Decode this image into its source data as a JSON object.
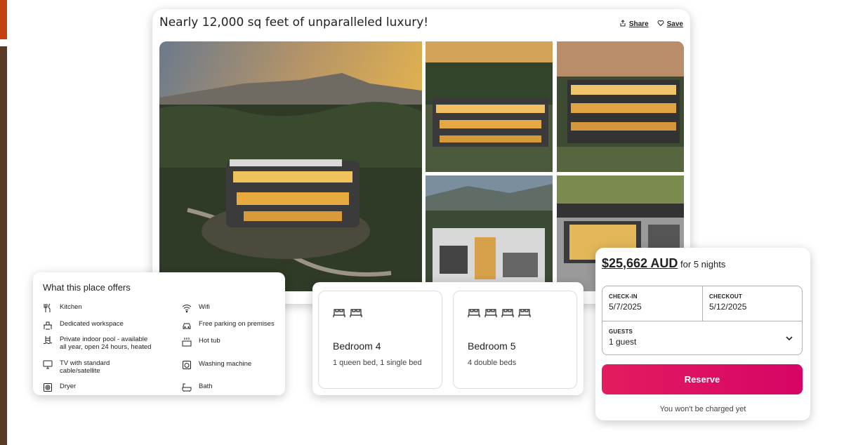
{
  "listing": {
    "title": "Nearly 12,000 sq feet of unparalleled luxury!",
    "share_label": "Share",
    "save_label": "Save"
  },
  "amenities": {
    "title": "What this place offers",
    "items": [
      {
        "label": "Kitchen",
        "icon": "kitchen-icon"
      },
      {
        "label": "Wifi",
        "icon": "wifi-icon"
      },
      {
        "label": "Dedicated workspace",
        "icon": "workspace-icon"
      },
      {
        "label": "Free parking on premises",
        "icon": "car-icon"
      },
      {
        "label": "Private indoor pool - available all year, open 24 hours, heated",
        "icon": "pool-icon"
      },
      {
        "label": "Hot tub",
        "icon": "hot-tub-icon"
      },
      {
        "label": "TV with standard cable/satellite",
        "icon": "tv-icon"
      },
      {
        "label": "Washing machine",
        "icon": "washing-machine-icon"
      },
      {
        "label": "Dryer",
        "icon": "dryer-icon"
      },
      {
        "label": "Bath",
        "icon": "bath-icon"
      }
    ]
  },
  "bedrooms": [
    {
      "name": "Bedroom 4",
      "beds": "1 queen bed, 1 single bed",
      "bed_icon_count": 2
    },
    {
      "name": "Bedroom 5",
      "beds": "4 double beds",
      "bed_icon_count": 4
    }
  ],
  "booking": {
    "price": "$25,662 AUD",
    "price_suffix": "for 5 nights",
    "checkin_label": "CHECK-IN",
    "checkin_value": "5/7/2025",
    "checkout_label": "CHECKOUT",
    "checkout_value": "5/12/2025",
    "guests_label": "GUESTS",
    "guests_value": "1 guest",
    "reserve_label": "Reserve",
    "note": "You won't be charged yet"
  },
  "colors": {
    "accent": "#e31c5f",
    "deco_orange": "#c4420f",
    "deco_brown": "#5a3a27"
  }
}
